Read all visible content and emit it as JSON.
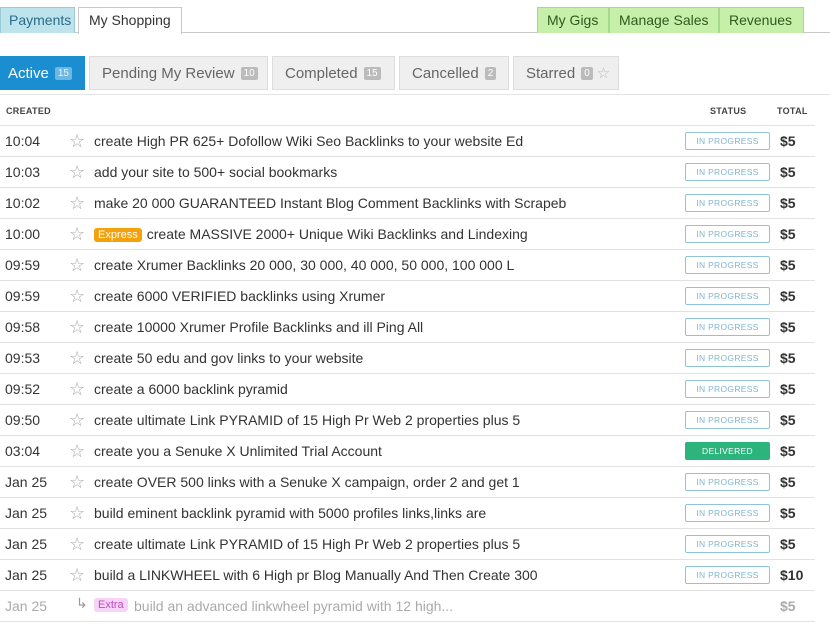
{
  "top_tabs": {
    "payments": "Payments",
    "shopping": "My Shopping",
    "gigs": "My Gigs",
    "sales": "Manage Sales",
    "revenues": "Revenues"
  },
  "filters": [
    {
      "label": "Active",
      "count": "15"
    },
    {
      "label": "Pending My Review",
      "count": "10"
    },
    {
      "label": "Completed",
      "count": "15"
    },
    {
      "label": "Cancelled",
      "count": "2"
    },
    {
      "label": "Starred",
      "count": "0"
    }
  ],
  "table": {
    "col_created": "CREATED",
    "col_status": "STATUS",
    "col_total": "TOTAL"
  },
  "orders": [
    {
      "time": "10:04",
      "title": "create High PR 625+ Dofollow Wiki Seo Backlinks to your website Ed",
      "status": "IN PROGRESS",
      "price": "$5"
    },
    {
      "time": "10:03",
      "title": "add your site to 500+ social bookmarks",
      "status": "IN PROGRESS",
      "price": "$5"
    },
    {
      "time": "10:02",
      "title": "make 20 000 GUARANTEED Instant Blog Comment Backlinks with Scrapeb",
      "status": "IN PROGRESS",
      "price": "$5"
    },
    {
      "time": "10:00",
      "badge": "Express",
      "title": "create MASSIVE 2000+ Unique Wiki Backlinks and Lindexing",
      "status": "IN PROGRESS",
      "price": "$5"
    },
    {
      "time": "09:59",
      "title": "create Xrumer Backlinks 20 000, 30 000, 40 000, 50 000, 100 000 L",
      "status": "IN PROGRESS",
      "price": "$5"
    },
    {
      "time": "09:59",
      "title": "create 6000 VERIFIED backlinks using Xrumer",
      "status": "IN PROGRESS",
      "price": "$5"
    },
    {
      "time": "09:58",
      "title": "create 10000 Xrumer Profile Backlinks and ill Ping All",
      "status": "IN PROGRESS",
      "price": "$5"
    },
    {
      "time": "09:53",
      "title": "create 50 edu and gov links to your website",
      "status": "IN PROGRESS",
      "price": "$5"
    },
    {
      "time": "09:52",
      "title": "create a 6000 backlink pyramid",
      "status": "IN PROGRESS",
      "price": "$5"
    },
    {
      "time": "09:50",
      "title": "create ultimate Link PYRAMID of 15 High Pr Web 2 properties plus 5",
      "status": "IN PROGRESS",
      "price": "$5"
    },
    {
      "time": "03:04",
      "title": "create you a Senuke X Unlimited Trial Account",
      "status": "DELIVERED",
      "price": "$5"
    },
    {
      "time": "Jan 25",
      "title": "create OVER 500 links with a Senuke X campaign, order 2 and get 1",
      "status": "IN PROGRESS",
      "price": "$5"
    },
    {
      "time": "Jan 25",
      "title": "build eminent backlink pyramid with 5000 profiles links,links are",
      "status": "IN PROGRESS",
      "price": "$5"
    },
    {
      "time": "Jan 25",
      "title": "create ultimate Link PYRAMID of 15 High Pr Web 2 properties plus 5",
      "status": "IN PROGRESS",
      "price": "$5"
    },
    {
      "time": "Jan 25",
      "title": "build a LINKWHEEL with 6 High pr Blog Manually And Then Create 300",
      "status": "IN PROGRESS",
      "price": "$10"
    }
  ],
  "extra_row": {
    "time": "Jan 25",
    "badge": "Extra",
    "title": "build an advanced linkwheel pyramid with 12 high...",
    "price": "$5"
  },
  "colors": {
    "accent": "#1a8ed1",
    "delivered": "#2db37c",
    "express": "#f5a10b"
  },
  "icons": {
    "star": "star-icon",
    "subitem": "subitem-arrow-icon"
  }
}
